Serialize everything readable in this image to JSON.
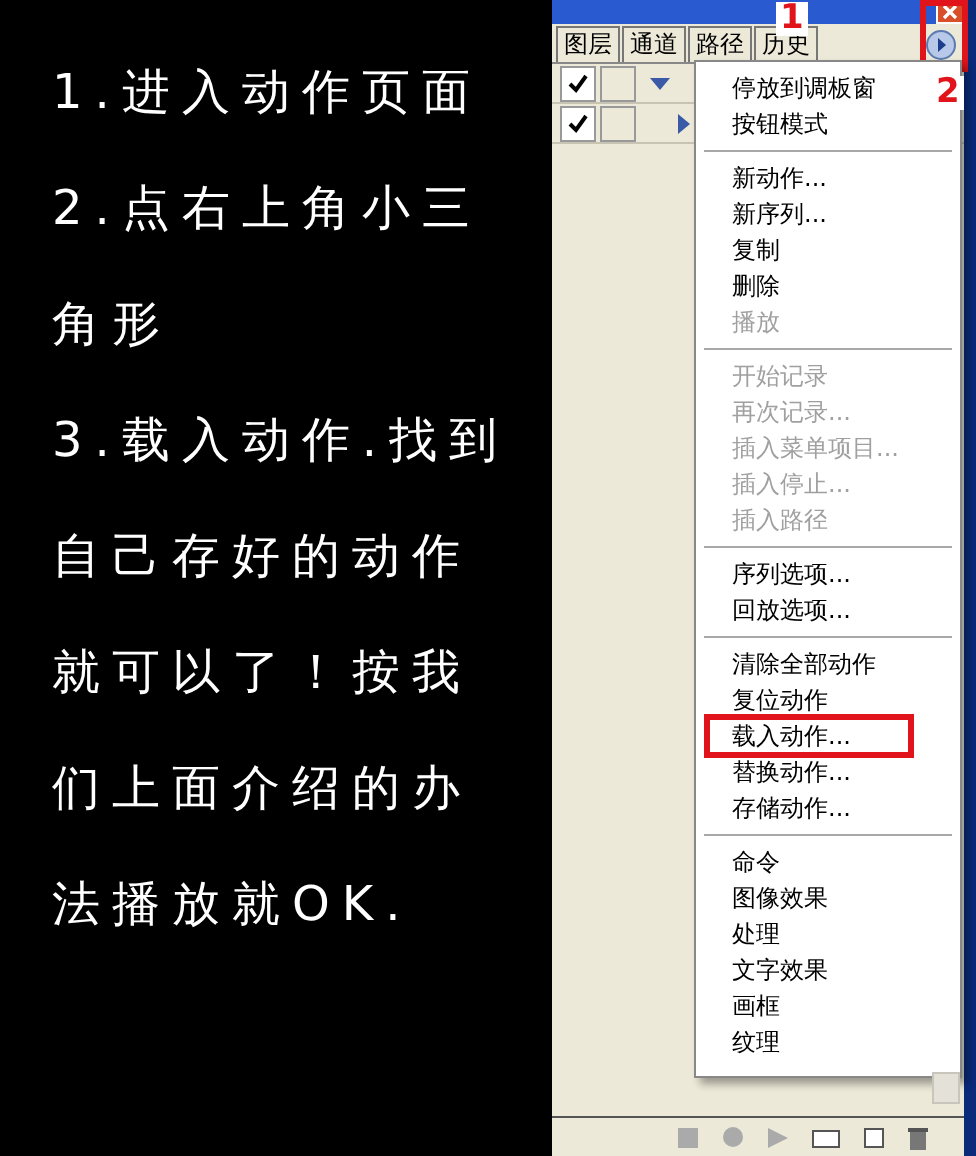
{
  "instructions": {
    "lines": [
      "1.进入动作页面",
      "2.点右上角小三",
      "角形",
      "3.载入动作.找到",
      "自己存好的动作",
      "就可以了！按我",
      "们上面介绍的办",
      "法播放就OK."
    ]
  },
  "panel": {
    "tabs": [
      {
        "label": "图层",
        "selected": false
      },
      {
        "label": "通道",
        "selected": false
      },
      {
        "label": "路径",
        "selected": false
      },
      {
        "label": "历史",
        "selected": false
      }
    ],
    "rows": [
      {
        "checked": true,
        "expanded": true
      },
      {
        "checked": true,
        "expanded": false
      }
    ],
    "menu": [
      {
        "kind": "item",
        "label": "停放到调板窗",
        "disabled": false
      },
      {
        "kind": "item",
        "label": "按钮模式",
        "disabled": false
      },
      {
        "kind": "separator"
      },
      {
        "kind": "item",
        "label": "新动作...",
        "disabled": false
      },
      {
        "kind": "item",
        "label": "新序列...",
        "disabled": false
      },
      {
        "kind": "item",
        "label": "复制",
        "disabled": false
      },
      {
        "kind": "item",
        "label": "删除",
        "disabled": false
      },
      {
        "kind": "item",
        "label": "播放",
        "disabled": true
      },
      {
        "kind": "separator"
      },
      {
        "kind": "item",
        "label": "开始记录",
        "disabled": true
      },
      {
        "kind": "item",
        "label": "再次记录...",
        "disabled": true
      },
      {
        "kind": "item",
        "label": "插入菜单项目...",
        "disabled": true
      },
      {
        "kind": "item",
        "label": "插入停止...",
        "disabled": true
      },
      {
        "kind": "item",
        "label": "插入路径",
        "disabled": true
      },
      {
        "kind": "separator"
      },
      {
        "kind": "item",
        "label": "序列选项...",
        "disabled": false
      },
      {
        "kind": "item",
        "label": "回放选项...",
        "disabled": false
      },
      {
        "kind": "separator"
      },
      {
        "kind": "item",
        "label": "清除全部动作",
        "disabled": false
      },
      {
        "kind": "item",
        "label": "复位动作",
        "disabled": false
      },
      {
        "kind": "item",
        "label": "载入动作...",
        "disabled": false,
        "outlined": true
      },
      {
        "kind": "item",
        "label": "替换动作...",
        "disabled": false
      },
      {
        "kind": "item",
        "label": "存储动作...",
        "disabled": false
      },
      {
        "kind": "separator"
      },
      {
        "kind": "item",
        "label": "命令",
        "disabled": false
      },
      {
        "kind": "item",
        "label": "图像效果",
        "disabled": false
      },
      {
        "kind": "item",
        "label": "处理",
        "disabled": false
      },
      {
        "kind": "item",
        "label": "文字效果",
        "disabled": false
      },
      {
        "kind": "item",
        "label": "画框",
        "disabled": false
      },
      {
        "kind": "item",
        "label": "纹理",
        "disabled": false
      }
    ]
  },
  "markers": [
    "1",
    "2"
  ]
}
